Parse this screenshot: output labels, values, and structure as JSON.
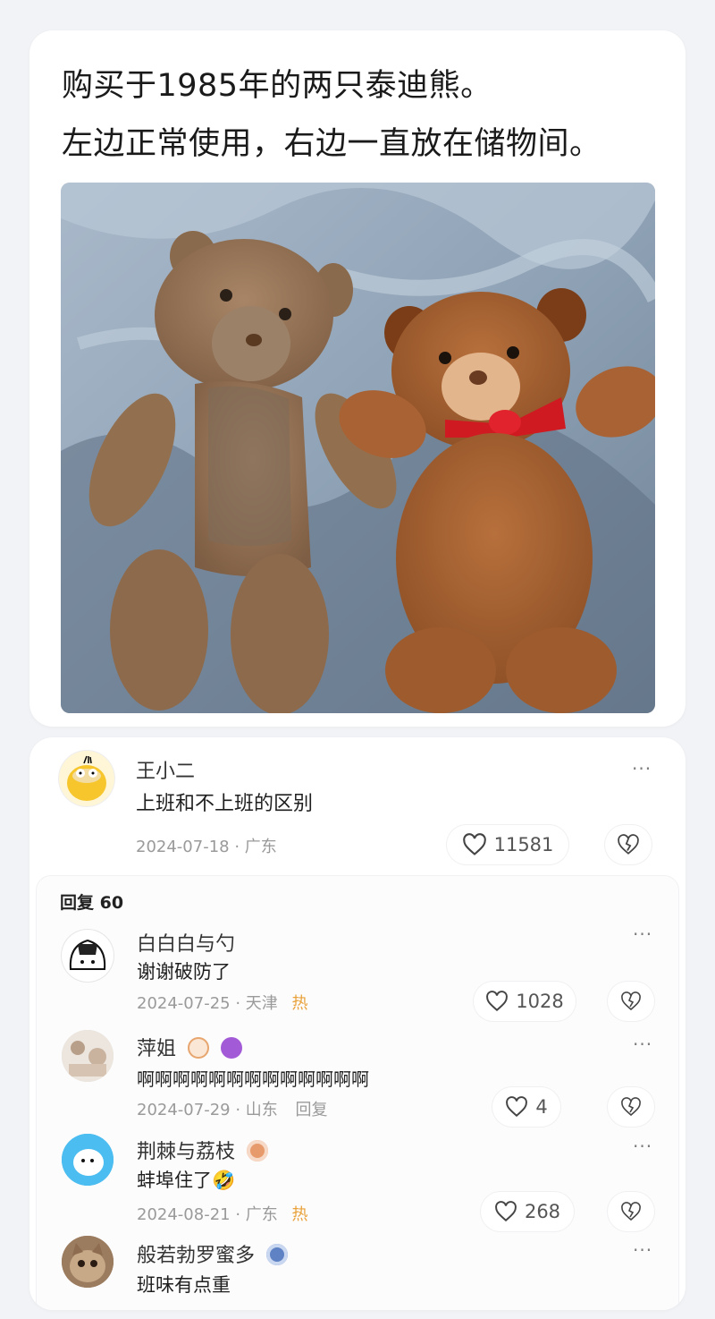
{
  "post": {
    "line1": "购买于1985年的两只泰迪熊。",
    "line2": "左边正常使用，右边一直放在储物间。"
  },
  "comment": {
    "author": "王小二",
    "text": "上班和不上班的区别",
    "date": "2024-07-18",
    "location": "广东",
    "likes": "11581",
    "more": "···"
  },
  "replies_header": "回复 60",
  "replies": [
    {
      "author": "白白白与勺",
      "text": "谢谢破防了",
      "date": "2024-07-25",
      "location": "天津",
      "tag": "热",
      "likes": "1028"
    },
    {
      "author": "萍姐",
      "text": "啊啊啊啊啊啊啊啊啊啊啊啊啊",
      "date": "2024-07-29",
      "location": "山东",
      "reply": "回复",
      "likes": "4"
    },
    {
      "author": "荆棘与荔枝",
      "text": "蚌埠住了🤣",
      "date": "2024-08-21",
      "location": "广东",
      "tag": "热",
      "likes": "268"
    },
    {
      "author": "般若勃罗蜜多",
      "text": "班味有点重"
    }
  ],
  "colors": {
    "background": "#f2f3f6",
    "card": "#ffffff",
    "hot_tag": "#e9a23b",
    "meta_text": "#9a9a9a"
  },
  "icons": [
    "heart-icon",
    "broken-heart-icon",
    "more-icon",
    "crown-badge-icon",
    "purple-badge-icon",
    "orange-badge-icon",
    "blue-badge-icon"
  ]
}
